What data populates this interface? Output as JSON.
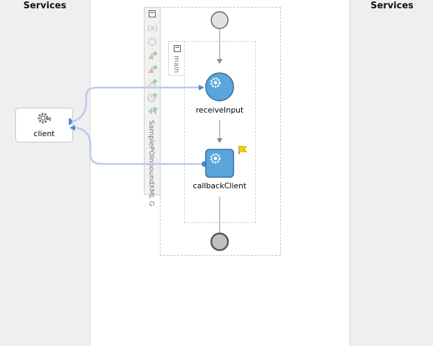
{
  "lanes": {
    "left_title": "Services",
    "right_title": "Services"
  },
  "client": {
    "label": "client"
  },
  "process": {
    "name": "SamplePOInboundXML G",
    "scope_label": "main",
    "activities": [
      {
        "label": "receiveInput",
        "icon": "gear-icon"
      },
      {
        "label": "callbackClient",
        "icon": "gear-icon"
      }
    ]
  },
  "toolbar": {
    "icons": [
      "variables-icon",
      "correlation-icon",
      "partnerlink-add-icon",
      "partnerlink-remove-icon",
      "fault-handler-icon",
      "event-handler-icon",
      "compensation-icon"
    ]
  },
  "colors": {
    "link": "#b9c8f2",
    "activity_fill": "#5aa5dc",
    "start_fill": "#e2e2e2",
    "end_fill": "#c0c0c0",
    "flag": "#f0d000"
  }
}
